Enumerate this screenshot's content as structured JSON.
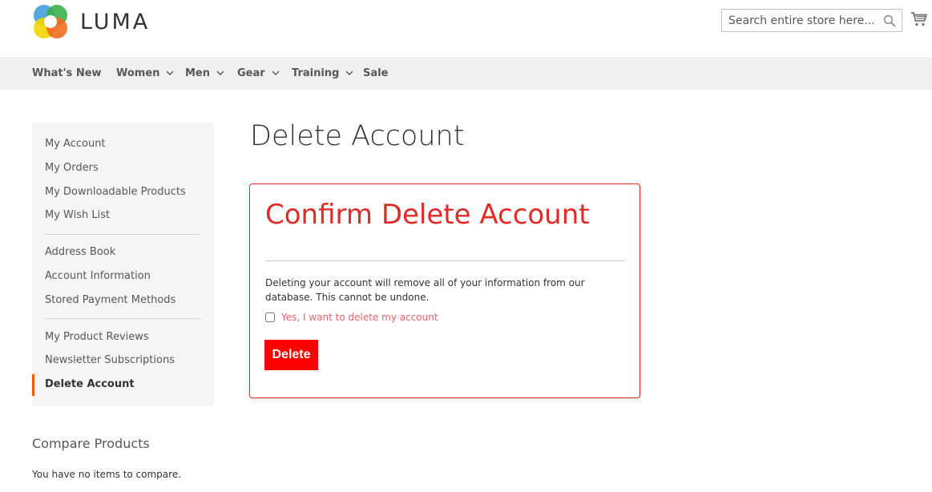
{
  "brand": {
    "name": "LUMA"
  },
  "search": {
    "placeholder": "Search entire store here..."
  },
  "nav": {
    "items": [
      {
        "label": "What's New",
        "has_dropdown": false
      },
      {
        "label": "Women",
        "has_dropdown": true
      },
      {
        "label": "Men",
        "has_dropdown": true
      },
      {
        "label": "Gear",
        "has_dropdown": true
      },
      {
        "label": "Training",
        "has_dropdown": true
      },
      {
        "label": "Sale",
        "has_dropdown": false
      }
    ]
  },
  "sidebar": {
    "items": [
      {
        "label": "My Account"
      },
      {
        "label": "My Orders"
      },
      {
        "label": "My Downloadable Products"
      },
      {
        "label": "My Wish List"
      },
      {
        "label": "Address Book"
      },
      {
        "label": "Account Information"
      },
      {
        "label": "Stored Payment Methods"
      },
      {
        "label": "My Product Reviews"
      },
      {
        "label": "Newsletter Subscriptions"
      },
      {
        "label": "Delete Account",
        "active": true
      }
    ]
  },
  "compare": {
    "title": "Compare Products",
    "empty_text": "You have no items to compare."
  },
  "main": {
    "page_title": "Delete Account",
    "panel": {
      "title": "Confirm Delete Account",
      "description": "Deleting your account will remove all of your information from our database. This cannot be undone.",
      "checkbox_label": "Yes, I want to delete my account",
      "checkbox_checked": false,
      "delete_label": "Delete"
    }
  },
  "colors": {
    "accent_red": "#e02b27",
    "button_red": "#ff0000",
    "nav_bg": "#f0f0f0",
    "sidebar_bg": "#f5f5f5",
    "active_marker": "#ff5501"
  },
  "icons": {
    "search": "search-icon",
    "cart": "cart-icon",
    "chevron": "chevron-down-icon"
  }
}
